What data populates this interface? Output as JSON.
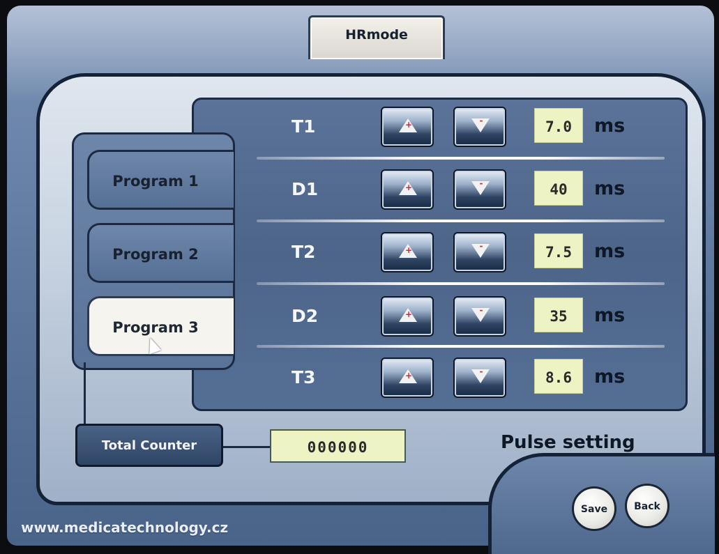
{
  "header": {
    "title": "HRmode"
  },
  "programs": [
    {
      "label": "Program 1",
      "active": false
    },
    {
      "label": "Program 2",
      "active": false
    },
    {
      "label": "Program 3",
      "active": true
    }
  ],
  "parameters": [
    {
      "name": "T1",
      "value": "7.0",
      "unit": "ms"
    },
    {
      "name": "D1",
      "value": "40",
      "unit": "ms"
    },
    {
      "name": "T2",
      "value": "7.5",
      "unit": "ms"
    },
    {
      "name": "D2",
      "value": "35",
      "unit": "ms"
    },
    {
      "name": "T3",
      "value": "8.6",
      "unit": "ms"
    }
  ],
  "counter": {
    "label": "Total Counter",
    "value": "000000"
  },
  "section": {
    "title": "Pulse setting"
  },
  "buttons": {
    "save": "Save",
    "back": "Back",
    "up_sign": "+",
    "down_sign": "-"
  },
  "footer": {
    "website": "www.medicatechnology.cz"
  },
  "colors": {
    "value_bg": "#eef3c4",
    "panel": "#5b7398",
    "active_program": "#f6f4ee"
  },
  "icons": {
    "up": "triangle-up-icon",
    "down": "triangle-down-icon",
    "pointer": "mouse-pointer-icon"
  }
}
